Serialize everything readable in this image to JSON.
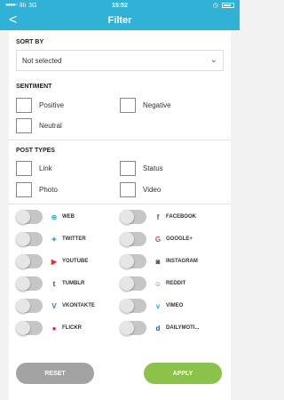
{
  "status_bar": {
    "carrier": "líti",
    "network": "3G",
    "time": "15:52"
  },
  "nav": {
    "title": "Filter",
    "back_glyph": "<"
  },
  "sort_by": {
    "label": "SORT BY",
    "value": "Not selected"
  },
  "sentiment": {
    "label": "SENTIMENT",
    "options": [
      "Positive",
      "Negative",
      "Neutral"
    ]
  },
  "post_types": {
    "label": "POST TYPES",
    "options": [
      "Link",
      "Status",
      "Photo",
      "Video"
    ]
  },
  "networks": [
    {
      "name": "WEB",
      "icon": "globe-icon",
      "color": "#2fb2d6",
      "enabled": false
    },
    {
      "name": "FACEBOOK",
      "icon": "facebook-icon",
      "color": "#3b5998",
      "enabled": false
    },
    {
      "name": "TWITTER",
      "icon": "twitter-icon",
      "color": "#1da1f2",
      "enabled": false
    },
    {
      "name": "GOOGLE+",
      "icon": "google-icon",
      "color": "#dd4b39",
      "enabled": false
    },
    {
      "name": "YOUTUBE",
      "icon": "youtube-icon",
      "color": "#e52d27",
      "enabled": false
    },
    {
      "name": "INSTAGRAM",
      "icon": "instagram-icon",
      "color": "#444444",
      "enabled": false
    },
    {
      "name": "TUMBLR",
      "icon": "tumblr-icon",
      "color": "#35465c",
      "enabled": false
    },
    {
      "name": "REDDIT",
      "icon": "reddit-icon",
      "color": "#ff4500",
      "enabled": false
    },
    {
      "name": "VKONTAKTE",
      "icon": "vk-icon",
      "color": "#4c75a3",
      "enabled": false
    },
    {
      "name": "VIMEO",
      "icon": "vimeo-icon",
      "color": "#1ab7ea",
      "enabled": false
    },
    {
      "name": "FLICKR",
      "icon": "flickr-icon",
      "color": "#ff0084",
      "enabled": false
    },
    {
      "name": "DAILYMOTI...",
      "icon": "dailymotion-icon",
      "color": "#0066dc",
      "enabled": false
    }
  ],
  "buttons": {
    "reset": "RESET",
    "apply": "APPLY"
  },
  "colors": {
    "accent": "#2fb2d6",
    "apply": "#8bc34a",
    "reset": "#a3a3a3",
    "toggle_off": "#c6c6c6"
  }
}
